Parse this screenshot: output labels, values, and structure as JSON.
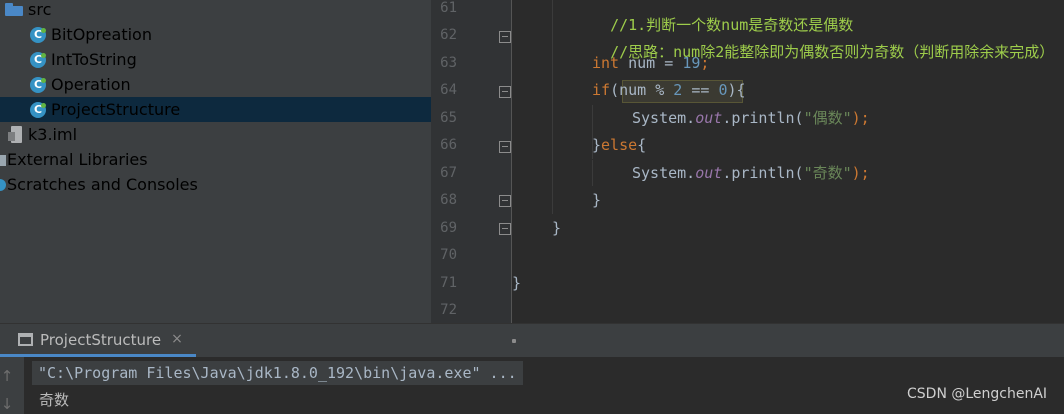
{
  "project_tree": {
    "items": [
      {
        "label": "src",
        "icon": "folder-icon"
      },
      {
        "label": "BitOpreation",
        "icon": "java-class-icon"
      },
      {
        "label": "IntToString",
        "icon": "java-class-icon"
      },
      {
        "label": "Operation",
        "icon": "java-class-icon"
      },
      {
        "label": "ProjectStructure",
        "icon": "java-class-icon",
        "selected": true
      },
      {
        "label": "k3.iml",
        "icon": "module-file-icon"
      },
      {
        "label": "External Libraries",
        "icon": "library-icon"
      },
      {
        "label": "Scratches and Consoles",
        "icon": "scratch-icon"
      }
    ]
  },
  "editor": {
    "line_numbers": [
      "61",
      "62",
      "63",
      "64",
      "65",
      "66",
      "67",
      "68",
      "69",
      "70",
      "71",
      "72"
    ],
    "code": {
      "l61": "//1.判断一个数num是奇数还是偶数",
      "l62": "//思路：num除2能整除即为偶数否则为奇数（判断用除余来完成）",
      "l63_kw": "int",
      "l63_mid": " num = ",
      "l63_num": "19",
      "l63_end": ";",
      "l64_kw": "if",
      "l64_a": "(num % ",
      "l64_n1": "2",
      "l64_b": " == ",
      "l64_n2": "0",
      "l64_c": "){",
      "l65_a": "System.",
      "l65_fld": "out",
      "l65_b": ".println(",
      "l65_str": "\"偶数\"",
      "l65_c": ");",
      "l66_a": "}",
      "l66_kw": "else",
      "l66_b": "{",
      "l67_a": "System.",
      "l67_fld": "out",
      "l67_b": ".println(",
      "l67_str": "\"奇数\"",
      "l67_c": ");",
      "l68": "}",
      "l69": "}",
      "l71": "}"
    }
  },
  "run_panel": {
    "tab_label": "ProjectStructure",
    "close_symbol": "×",
    "command_line": "\"C:\\Program Files\\Java\\jdk1.8.0_192\\bin\\java.exe\" ...",
    "output_line": "奇数",
    "up_arrow": "↑",
    "down_arrow": "↓"
  },
  "watermark": "CSDN @LengchenAI",
  "colors": {
    "background": "#2b2b2b",
    "panel": "#3c3f41",
    "selection": "#0d293e",
    "keyword": "#cc7832",
    "number": "#6897bb",
    "string": "#6a8759",
    "comment": "#629755",
    "field": "#9876aa",
    "accent": "#4a88c7"
  }
}
